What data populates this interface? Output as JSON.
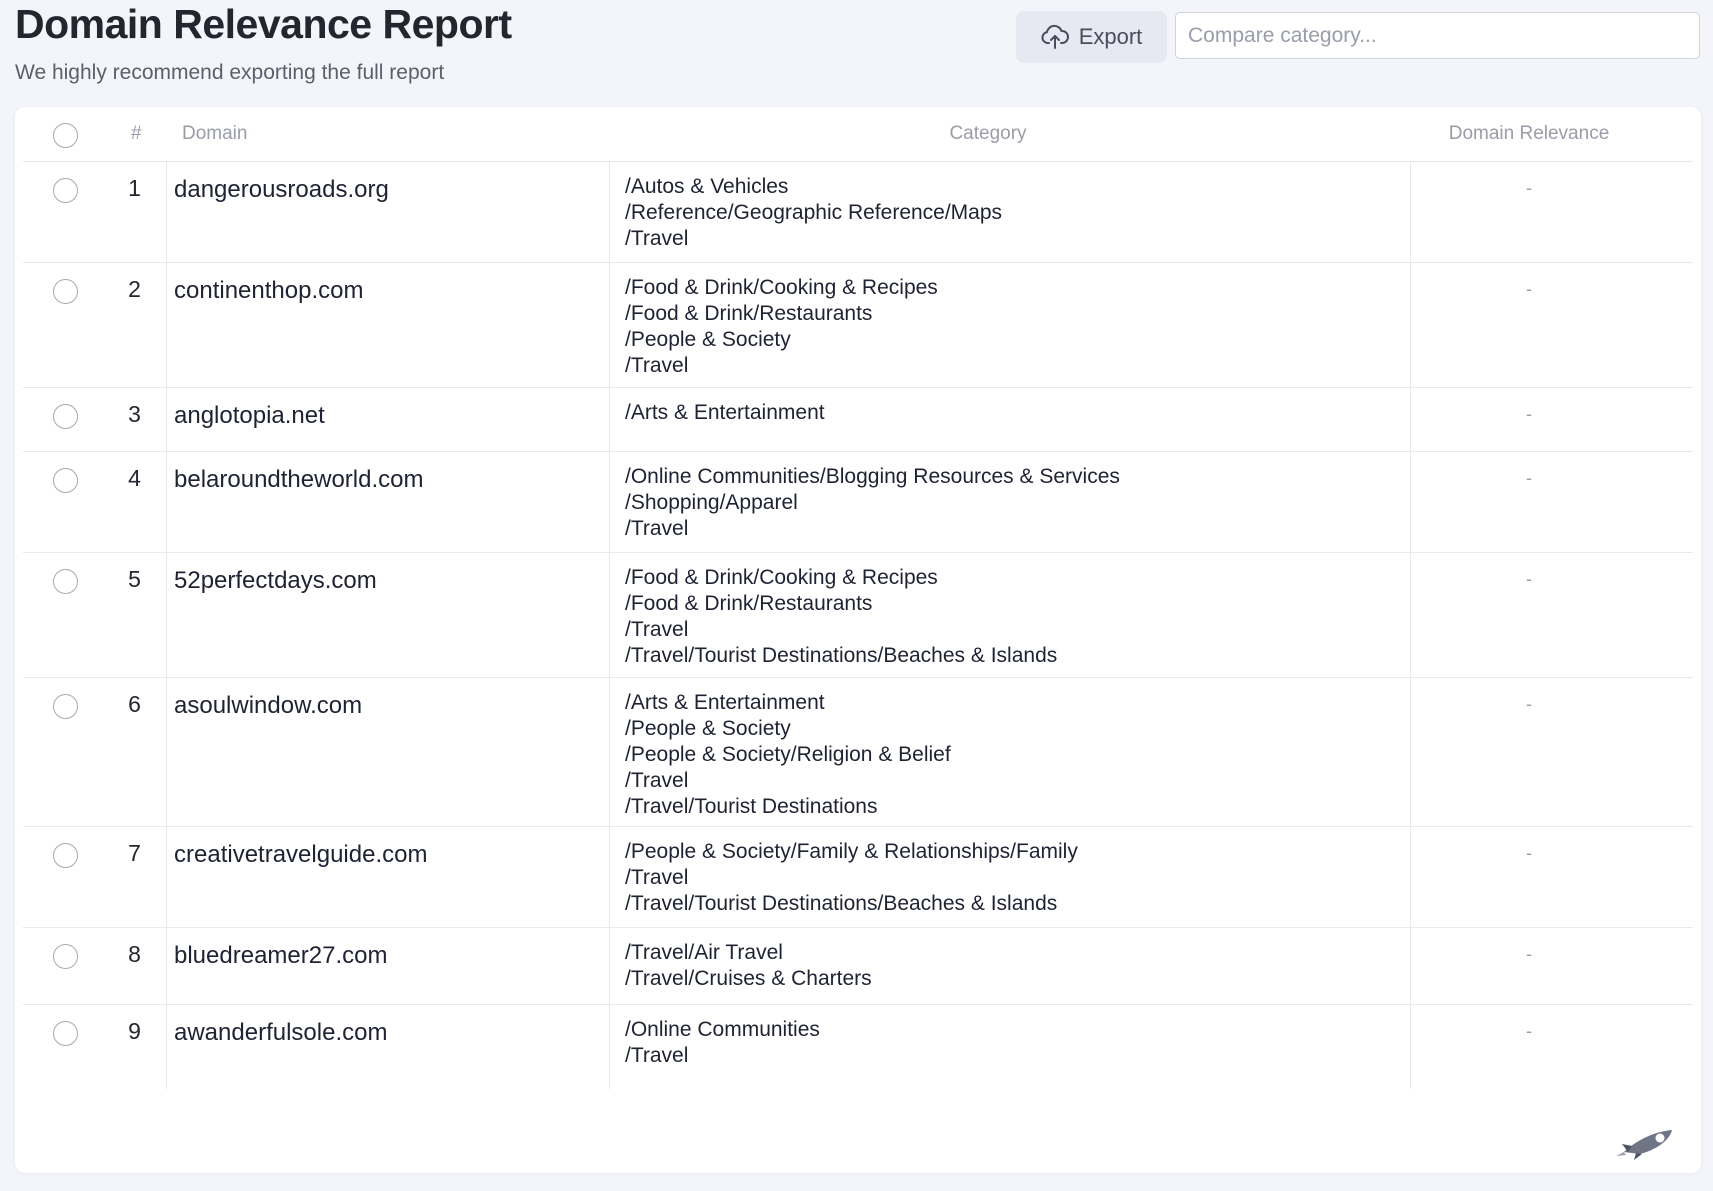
{
  "header": {
    "title": "Domain Relevance Report",
    "subtitle": "We highly recommend exporting the full report"
  },
  "toolbar": {
    "export_label": "Export",
    "export_icon": "cloud-upload-icon",
    "compare_placeholder": "Compare category..."
  },
  "table": {
    "columns": {
      "num": "#",
      "domain": "Domain",
      "category": "Category",
      "relevance": "Domain Relevance"
    },
    "rows": [
      {
        "num": "1",
        "domain": "dangerousroads.org",
        "category": "/Autos & Vehicles\n/Reference/Geographic Reference/Maps\n/Travel",
        "relevance": "-"
      },
      {
        "num": "2",
        "domain": "continenthop.com",
        "category": "/Food & Drink/Cooking & Recipes\n/Food & Drink/Restaurants\n/People & Society\n/Travel",
        "relevance": "-"
      },
      {
        "num": "3",
        "domain": "anglotopia.net",
        "category": "/Arts & Entertainment",
        "relevance": "-"
      },
      {
        "num": "4",
        "domain": "belaroundtheworld.com",
        "category": "/Online Communities/Blogging Resources & Services\n/Shopping/Apparel\n/Travel",
        "relevance": "-"
      },
      {
        "num": "5",
        "domain": "52perfectdays.com",
        "category": "/Food & Drink/Cooking & Recipes\n/Food & Drink/Restaurants\n/Travel\n/Travel/Tourist Destinations/Beaches & Islands",
        "relevance": "-"
      },
      {
        "num": "6",
        "domain": "asoulwindow.com",
        "category": "/Arts & Entertainment\n/People & Society\n/People & Society/Religion & Belief\n/Travel\n/Travel/Tourist Destinations",
        "relevance": "-"
      },
      {
        "num": "7",
        "domain": "creativetravelguide.com",
        "category": "/People & Society/Family & Relationships/Family\n/Travel\n/Travel/Tourist Destinations/Beaches & Islands",
        "relevance": "-"
      },
      {
        "num": "8",
        "domain": "bluedreamer27.com",
        "category": "/Travel/Air Travel\n/Travel/Cruises & Charters",
        "relevance": "-"
      },
      {
        "num": "9",
        "domain": "awanderfulsole.com",
        "category": "/Online Communities\n/Travel",
        "relevance": "-"
      }
    ]
  },
  "floating": {
    "rocket_icon": "rocket-icon"
  }
}
